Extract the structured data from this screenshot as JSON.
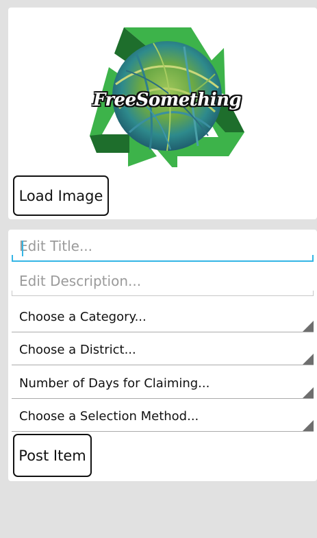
{
  "logo": {
    "text": "FreeSomething"
  },
  "image_section": {
    "load_button": "Load Image"
  },
  "form": {
    "title_placeholder": "Edit Title...",
    "description_placeholder": "Edit Description...",
    "category_spinner": "Choose a Category...",
    "district_spinner": "Choose a District...",
    "days_spinner": "Number of Days for Claiming...",
    "method_spinner": "Choose a Selection Method...",
    "post_button": "Post Item"
  },
  "colors": {
    "background": "#e1e1e1",
    "card": "#ffffff",
    "focus_underline": "#33b5e5",
    "recycle_green": "#3db34a",
    "recycle_dark_green": "#1e6e2c"
  }
}
